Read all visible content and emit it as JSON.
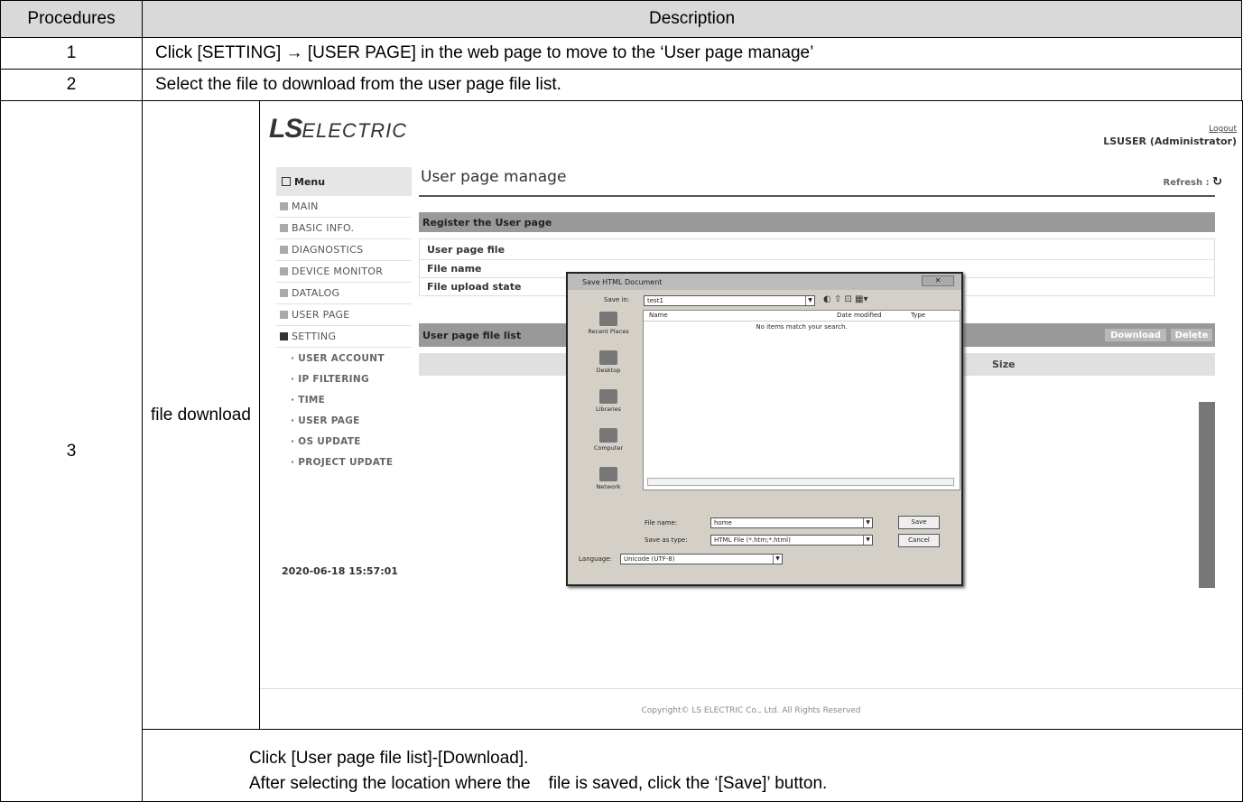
{
  "table": {
    "header": {
      "procedures": "Procedures",
      "description": "Description"
    },
    "rows": [
      {
        "num": "1",
        "text": "Click [SETTING] → [USER PAGE] in the web page to move to the ‘User page manage’"
      },
      {
        "num": "2",
        "text": "Select the file to download from the user page file list."
      },
      {
        "num": "3",
        "label": "file download"
      }
    ],
    "note_line1": "Click [User page file list]-[Download].",
    "note_line2_a": "After selecting the location where the",
    "note_line2_b": "file is saved, click the ‘[Save]’ button."
  },
  "screenshot": {
    "brand_logo": "LS ELECTRIC",
    "logout": "Logout",
    "user": "LSUSER (Administrator)",
    "menu_title": "Menu",
    "menu": [
      "MAIN",
      "BASIC INFO.",
      "DIAGNOSTICS",
      "DEVICE MONITOR",
      "DATALOG",
      "USER PAGE",
      "SETTING"
    ],
    "submenu": [
      "· USER ACCOUNT",
      "· IP FILTERING",
      "· TIME",
      "· USER PAGE",
      "· OS UPDATE",
      "· PROJECT UPDATE"
    ],
    "timestamp": "2020-06-18 15:57:01",
    "page_title": "User page manage",
    "refresh": "Refresh :",
    "register_bar": "Register the User page",
    "fields": [
      "User page file",
      "File name",
      "File upload state"
    ],
    "list_bar": "User page file list",
    "download": "Download",
    "delete": "Delete",
    "col_size": "Size",
    "copyright": "Copyright© LS ELECTRIC Co., Ltd. All Rights Reserved"
  },
  "dialog": {
    "title": "Save HTML Document",
    "save_in_label": "Save in:",
    "save_in_value": "test1",
    "places": [
      "Recent Places",
      "Desktop",
      "Libraries",
      "Computer",
      "Network"
    ],
    "col_name": "Name",
    "col_date": "Date modified",
    "col_type": "Type",
    "empty": "No items match your search.",
    "file_name_label": "File name:",
    "file_name_value": "home",
    "type_label": "Save as type:",
    "type_value": "HTML File (*.htm;*.html)",
    "language_label": "Language:",
    "language_value": "Unicode (UTF-8)",
    "save": "Save",
    "cancel": "Cancel"
  }
}
